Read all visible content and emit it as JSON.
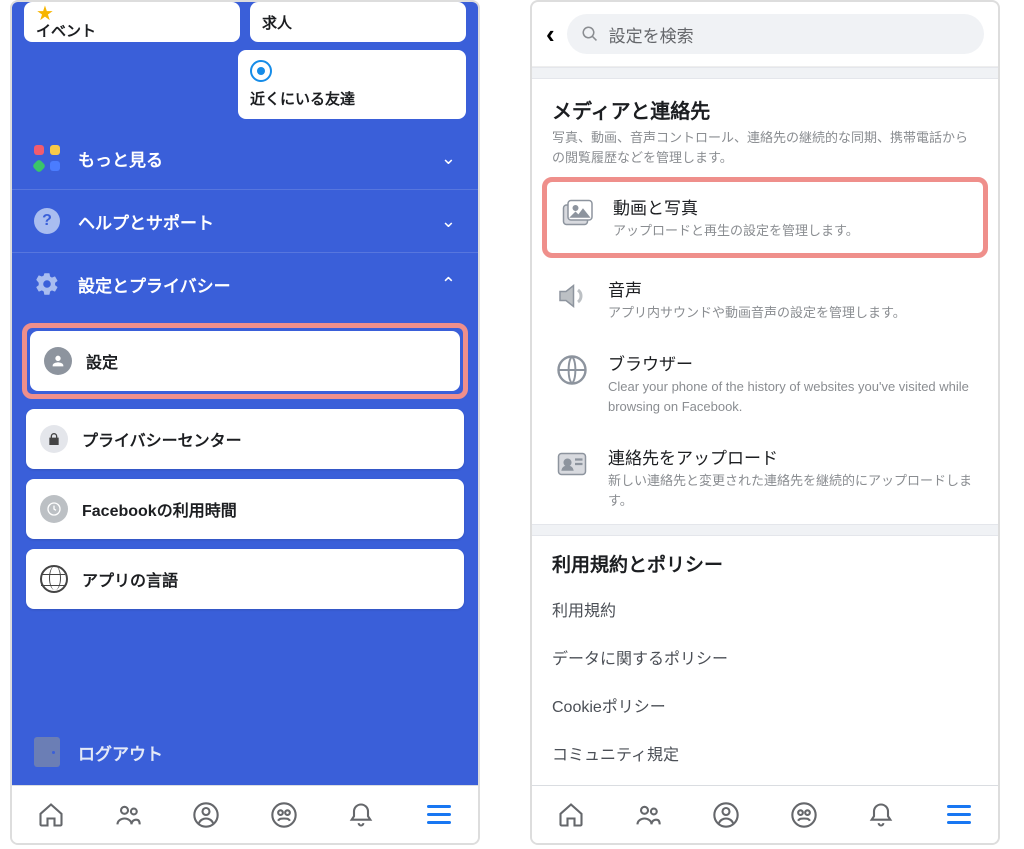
{
  "left": {
    "tiles": {
      "events": "イベント",
      "jobs": "求人",
      "nearby": "近くにいる友達"
    },
    "rows": {
      "more": "もっと見る",
      "help": "ヘルプとサポート",
      "settings_privacy": "設定とプライバシー"
    },
    "cards": {
      "settings": "設定",
      "privacy_center": "プライバシーセンター",
      "time_fb": "Facebookの利用時間",
      "app_lang": "アプリの言語"
    },
    "logout": "ログアウト"
  },
  "right": {
    "search_placeholder": "設定を検索",
    "media_section": {
      "title": "メディアと連絡先",
      "desc": "写真、動画、音声コントロール、連絡先の継続的な同期、携帯電話からの閲覧履歴などを管理します。"
    },
    "items": {
      "video_photo": {
        "t": "動画と写真",
        "s": "アップロードと再生の設定を管理します。"
      },
      "audio": {
        "t": "音声",
        "s": "アプリ内サウンドや動画音声の設定を管理します。"
      },
      "browser": {
        "t": "ブラウザー",
        "s": "Clear your phone of the history of websites you've visited while browsing on Facebook."
      },
      "contacts": {
        "t": "連絡先をアップロード",
        "s": "新しい連絡先と変更された連絡先を継続的にアップロードします。"
      }
    },
    "policy_title": "利用規約とポリシー",
    "policies": {
      "terms": "利用規約",
      "data": "データに関するポリシー",
      "cookie": "Cookieポリシー",
      "community": "コミュニティ規定"
    }
  }
}
